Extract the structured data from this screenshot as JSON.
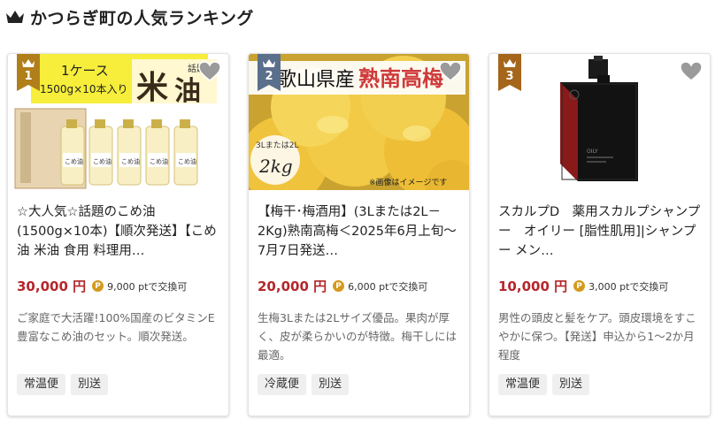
{
  "page": {
    "title": "かつらぎ町の人気ランキング"
  },
  "cards": [
    {
      "rank": "1",
      "title": "☆大人気☆話題のこめ油(1500g×10本)【順次発送】【こめ油 米油 食用 料理用…",
      "price": "30,000 円",
      "points": "9,000 ptで交換可",
      "desc": "ご家庭で大活躍!100%国産のビタミンE豊富なこめ油のセット。順次発送。",
      "tags": [
        "常温便",
        "別送"
      ],
      "image": {
        "banner_text": "1ケース",
        "banner_sub": "1500g×10本入り",
        "badge_text": "話題の",
        "big_text": "米",
        "big_text2": "油",
        "bottle_label": "こめ油"
      }
    },
    {
      "rank": "2",
      "title": "【梅干･梅酒用】(3Lまたは2L－2Kg)熟南高梅＜2025年6月上旬～7月7日発送…",
      "price": "20,000 円",
      "points": "6,000 ptで交換可",
      "desc": "生梅3Lまたは2Lサイズ優品。果肉が厚く、皮が柔らかいのが特徴。梅干しには最適。",
      "tags": [
        "冷蔵便",
        "別送"
      ],
      "image": {
        "banner_text1": "歌山県産",
        "banner_text2": "熟南高梅",
        "size_label": "3Lまたは2L",
        "weight_label": "2kg",
        "note": "※画像はイメージです"
      }
    },
    {
      "rank": "3",
      "title": "スカルプD　薬用スカルプシャンプー　オイリー [脂性肌用]|シャンプー メン…",
      "price": "10,000 円",
      "points": "3,000 ptで交換可",
      "desc": "男性の頭皮と髪をケア。頭皮環境をすこやかに保つ。【発送】申込から1～2か月程度",
      "tags": [
        "常温便",
        "別送"
      ],
      "image": {
        "bottle_label": "OILY"
      }
    }
  ],
  "colors": {
    "price": "#b5262b",
    "rank_badge": "#b07f1a",
    "point_icon": "#d49a1d",
    "heart": "#9a9a9a"
  },
  "icons": {
    "header": "crown-icon",
    "favorite": "heart-icon",
    "point": "point-coin-icon"
  }
}
